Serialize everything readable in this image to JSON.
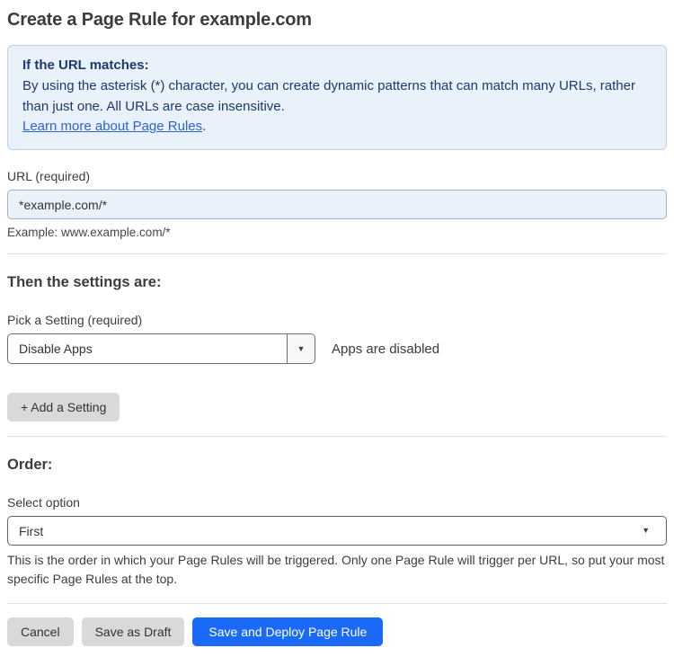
{
  "page": {
    "title": "Create a Page Rule for example.com"
  },
  "info_box": {
    "heading": "If the URL matches:",
    "body": "By using the asterisk (*) character, you can create dynamic patterns that can match many URLs, rather than just one. All URLs are case insensitive.",
    "link_label": "Learn more about Page Rules",
    "link_suffix": "."
  },
  "url_field": {
    "label": "URL (required)",
    "value": "*example.com/*",
    "helper": "Example: www.example.com/*"
  },
  "settings_section": {
    "heading": "Then the settings are:",
    "setting_label": "Pick a Setting (required)",
    "setting_value": "Disable Apps",
    "setting_status": "Apps are disabled",
    "add_setting_label": "+ Add a Setting"
  },
  "order_section": {
    "heading": "Order:",
    "select_label": "Select option",
    "select_value": "First",
    "helper": "This is the order in which your Page Rules will be triggered. Only one Page Rule will trigger per URL, so put your most specific Page Rules at the top."
  },
  "actions": {
    "cancel": "Cancel",
    "save_draft": "Save as Draft",
    "save_deploy": "Save and Deploy Page Rule"
  },
  "icons": {
    "dropdown_arrow": "▼",
    "select_chevron": "▼"
  },
  "colors": {
    "accent_blue": "#1a6af7",
    "info_box_bg": "#e9f1fb",
    "info_box_border": "#b9d2f0",
    "info_text": "#1d3a6d",
    "link_blue": "#2d62d9",
    "input_bg": "#e9f1fb",
    "gray_button_bg": "#d9d9d9"
  }
}
